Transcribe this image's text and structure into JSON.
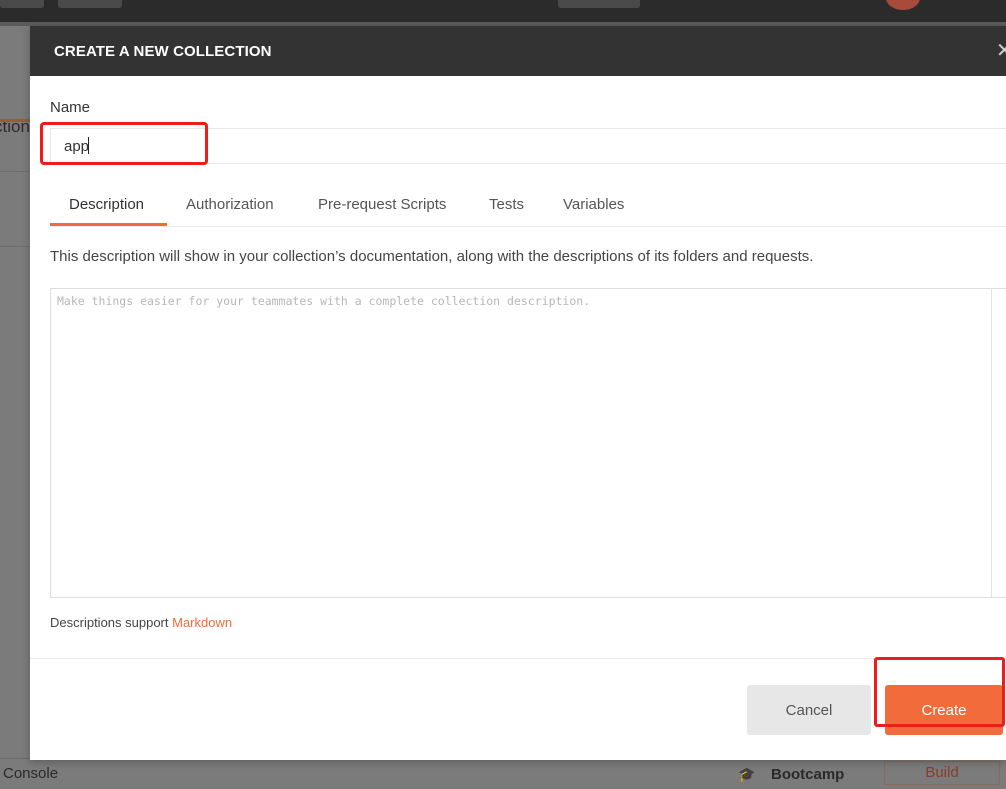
{
  "modal": {
    "title": "CREATE A NEW COLLECTION",
    "name_label": "Name",
    "name_value": "app",
    "tabs": [
      {
        "label": "Description",
        "active": true
      },
      {
        "label": "Authorization",
        "active": false
      },
      {
        "label": "Pre-request Scripts",
        "active": false
      },
      {
        "label": "Tests",
        "active": false
      },
      {
        "label": "Variables",
        "active": false
      }
    ],
    "description_info": "This description will show in your collection’s documentation, along with the descriptions of its folders and requests.",
    "description_placeholder": "Make things easier for your teammates with a complete collection description.",
    "markdown_note": "Descriptions support",
    "markdown_link": "Markdown",
    "cancel_label": "Cancel",
    "create_label": "Create"
  },
  "background": {
    "tab_fragment": "ctions",
    "console_label": "Console",
    "bootcamp_label": "Bootcamp",
    "build_label": "Build"
  },
  "colors": {
    "accent": "#f26b3a",
    "header_bg": "#333333",
    "highlight": "#ef1c1c"
  },
  "icons": {
    "close": "close-icon",
    "bootcamp": "graduation-cap-icon"
  }
}
